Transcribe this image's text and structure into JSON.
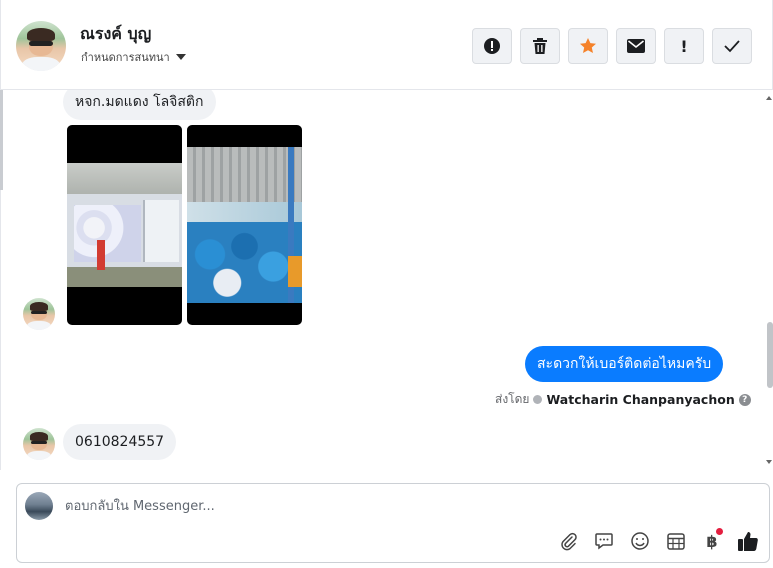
{
  "header": {
    "name": "ณรงค์ บุญ",
    "assign_label": "กำหนดการสนทนา",
    "tools": [
      {
        "name": "alert-icon",
        "glyph": ""
      },
      {
        "name": "trash-icon",
        "glyph": ""
      },
      {
        "name": "star-icon",
        "glyph": ""
      },
      {
        "name": "envelope-icon",
        "glyph": ""
      },
      {
        "name": "exclamation-icon",
        "glyph": "!"
      },
      {
        "name": "check-icon",
        "glyph": ""
      }
    ]
  },
  "messages": {
    "incoming_top": "หจก.มดแดง โลจิสติก",
    "outgoing": "สะดวกให้เบอร์ติดต่อไหมครับ",
    "sent_by_label": "ส่งโดย",
    "sent_by_name": "Watcharin Chanpanyachon",
    "incoming_phone": "0610824557"
  },
  "composer": {
    "placeholder": "ตอบกลับใน Messenger...",
    "tools": [
      "paperclip-icon",
      "speech-bubble-icon",
      "smiley-icon",
      "calendar-icon",
      "baht-icon",
      "thumbs-up-icon"
    ],
    "baht_glyph": "฿"
  },
  "colors": {
    "accent": "#0a7cff",
    "star": "#f5822a",
    "bubble_in": "#f0f2f5",
    "notification_dot": "#e41e3f"
  }
}
